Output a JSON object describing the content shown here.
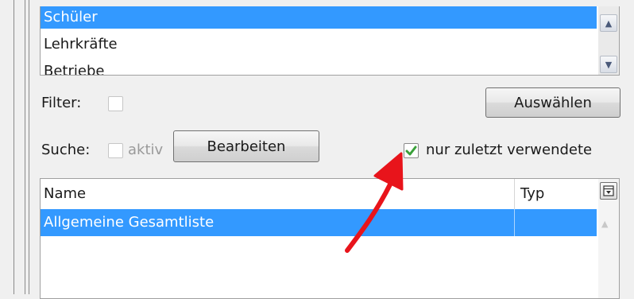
{
  "list": {
    "items": [
      {
        "label": "Schüler",
        "selected": true
      },
      {
        "label": "Lehrkräfte",
        "selected": false
      },
      {
        "label": "Betriebe",
        "selected": false
      }
    ],
    "scroll_up_icon": "triangle-up",
    "scroll_down_icon": "triangle-down"
  },
  "filter": {
    "label": "Filter:",
    "checked": false
  },
  "select_button": {
    "label": "Auswählen"
  },
  "search": {
    "label": "Suche:",
    "aktiv_label": "aktiv",
    "aktiv_checked": false
  },
  "edit_button": {
    "label": "Bearbeiten"
  },
  "recent_only": {
    "label": "nur zuletzt verwendete",
    "checked": true
  },
  "grid": {
    "columns": [
      "Name",
      "Typ"
    ],
    "rows": [
      {
        "name": "Allgemeine Gesamtliste",
        "typ": "",
        "selected": true
      }
    ],
    "column_chooser_icon": "column-chooser"
  },
  "annotation": {
    "color": "#e8141b",
    "icon": "red-arrow"
  },
  "colors": {
    "selection": "#3399ff",
    "checkmark": "#3aa13a"
  }
}
